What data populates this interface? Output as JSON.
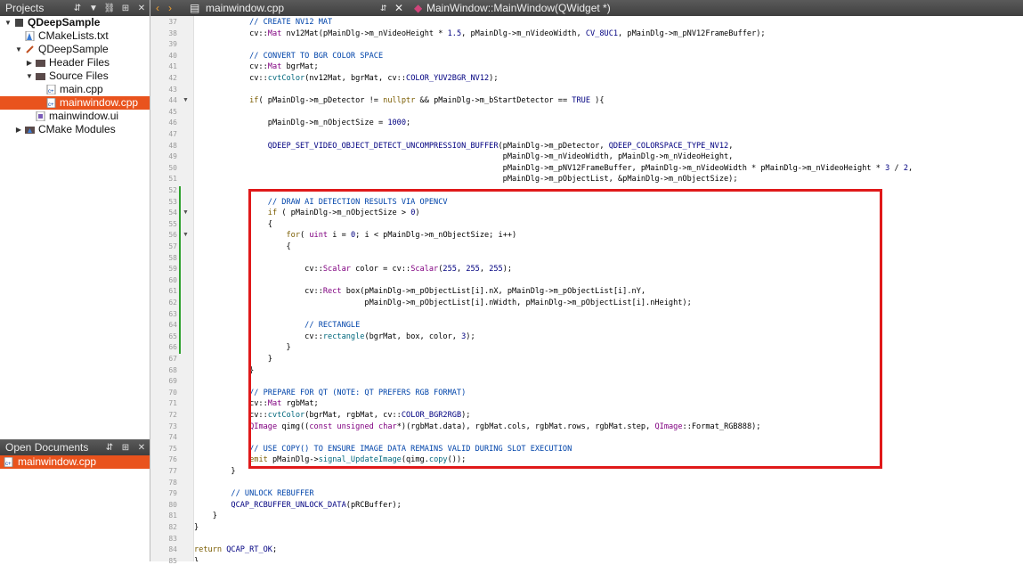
{
  "projects_panel": {
    "title": "Projects",
    "tree": [
      {
        "label": "QDeepSample",
        "depth": 0,
        "expanded": true,
        "bold": true,
        "icon": "project-icon"
      },
      {
        "label": "CMakeLists.txt",
        "depth": 1,
        "icon": "cmake-file-icon"
      },
      {
        "label": "QDeepSample",
        "depth": 1,
        "expanded": true,
        "icon": "target-icon"
      },
      {
        "label": "Header Files",
        "depth": 2,
        "expanded": false,
        "icon": "folder-icon"
      },
      {
        "label": "Source Files",
        "depth": 2,
        "expanded": true,
        "icon": "folder-icon"
      },
      {
        "label": "main.cpp",
        "depth": 3,
        "icon": "cpp-file-icon"
      },
      {
        "label": "mainwindow.cpp",
        "depth": 3,
        "icon": "cpp-file-icon",
        "selected": true
      },
      {
        "label": "mainwindow.ui",
        "depth": 2,
        "icon": "ui-file-icon"
      },
      {
        "label": "CMake Modules",
        "depth": 1,
        "expanded": false,
        "icon": "cmake-folder-icon"
      }
    ]
  },
  "open_documents": {
    "title": "Open Documents",
    "items": [
      {
        "label": "mainwindow.cpp",
        "selected": true
      }
    ]
  },
  "editor": {
    "file_tab": "mainwindow.cpp",
    "symbol": "MainWindow::MainWindow(QWidget *)",
    "lines": [
      {
        "n": "37",
        "t": "            // CREATE NV12 MAT"
      },
      {
        "n": "38",
        "t": "            cv::Mat nv12Mat(pMainDlg->m_nVideoHeight * 1.5, pMainDlg->m_nVideoWidth, CV_8UC1, pMainDlg->m_pNV12FrameBuffer);"
      },
      {
        "n": "39",
        "t": ""
      },
      {
        "n": "40",
        "t": "            // CONVERT TO BGR COLOR SPACE"
      },
      {
        "n": "41",
        "t": "            cv::Mat bgrMat;"
      },
      {
        "n": "42",
        "t": "            cv::cvtColor(nv12Mat, bgrMat, cv::COLOR_YUV2BGR_NV12);"
      },
      {
        "n": "43",
        "t": ""
      },
      {
        "n": "44",
        "t": "            if( pMainDlg->m_pDetector != nullptr && pMainDlg->m_bStartDetector == TRUE ){"
      },
      {
        "n": "45",
        "t": ""
      },
      {
        "n": "46",
        "t": "                pMainDlg->m_nObjectSize = 1000;"
      },
      {
        "n": "47",
        "t": ""
      },
      {
        "n": "48",
        "t": "                QDEEP_SET_VIDEO_OBJECT_DETECT_UNCOMPRESSION_BUFFER(pMainDlg->m_pDetector, QDEEP_COLORSPACE_TYPE_NV12,"
      },
      {
        "n": "49",
        "t": "                                                                   pMainDlg->m_nVideoWidth, pMainDlg->m_nVideoHeight,"
      },
      {
        "n": "50",
        "t": "                                                                   pMainDlg->m_pNV12FrameBuffer, pMainDlg->m_nVideoWidth * pMainDlg->m_nVideoHeight * 3 / 2,"
      },
      {
        "n": "51",
        "t": "                                                                   pMainDlg->m_pObjectList, &pMainDlg->m_nObjectSize);"
      },
      {
        "n": "52",
        "t": ""
      },
      {
        "n": "53",
        "t": "                // DRAW AI DETECTION RESULTS VIA OPENCV"
      },
      {
        "n": "54",
        "t": "                if ( pMainDlg->m_nObjectSize > 0)"
      },
      {
        "n": "55",
        "t": "                {"
      },
      {
        "n": "56",
        "t": "                    for( uint i = 0; i < pMainDlg->m_nObjectSize; i++)"
      },
      {
        "n": "57",
        "t": "                    {"
      },
      {
        "n": "58",
        "t": ""
      },
      {
        "n": "59",
        "t": "                        cv::Scalar color = cv::Scalar(255, 255, 255);"
      },
      {
        "n": "60",
        "t": ""
      },
      {
        "n": "61",
        "t": "                        cv::Rect box(pMainDlg->m_pObjectList[i].nX, pMainDlg->m_pObjectList[i].nY,"
      },
      {
        "n": "62",
        "t": "                                     pMainDlg->m_pObjectList[i].nWidth, pMainDlg->m_pObjectList[i].nHeight);"
      },
      {
        "n": "63",
        "t": ""
      },
      {
        "n": "64",
        "t": "                        // RECTANGLE"
      },
      {
        "n": "65",
        "t": "                        cv::rectangle(bgrMat, box, color, 3);"
      },
      {
        "n": "66",
        "t": "                    }"
      },
      {
        "n": "67",
        "t": "                }"
      },
      {
        "n": "68",
        "t": "            }"
      },
      {
        "n": "69",
        "t": ""
      },
      {
        "n": "70",
        "t": "            // PREPARE FOR QT (NOTE: QT PREFERS RGB FORMAT)"
      },
      {
        "n": "71",
        "t": "            cv::Mat rgbMat;"
      },
      {
        "n": "72",
        "t": "            cv::cvtColor(bgrMat, rgbMat, cv::COLOR_BGR2RGB);"
      },
      {
        "n": "73",
        "t": "            QImage qimg((const unsigned char*)(rgbMat.data), rgbMat.cols, rgbMat.rows, rgbMat.step, QImage::Format_RGB888);"
      },
      {
        "n": "74",
        "t": ""
      },
      {
        "n": "75",
        "t": "            // USE COPY() TO ENSURE IMAGE DATA REMAINS VALID DURING SLOT EXECUTION"
      },
      {
        "n": "76",
        "t": "            emit pMainDlg->signal_UpdateImage(qimg.copy());"
      },
      {
        "n": "77",
        "t": "        }"
      },
      {
        "n": "78",
        "t": ""
      },
      {
        "n": "79",
        "t": "        // UNLOCK REBUFFER"
      },
      {
        "n": "80",
        "t": "        QCAP_RCBUFFER_UNLOCK_DATA(pRCBuffer);"
      },
      {
        "n": "81",
        "t": "    }"
      },
      {
        "n": "82",
        "t": "}"
      },
      {
        "n": "83",
        "t": ""
      },
      {
        "n": "84",
        "t": "return QCAP_RT_OK;"
      },
      {
        "n": "85",
        "t": "}"
      }
    ],
    "fold_markers": [
      "44",
      "54",
      "56"
    ]
  },
  "colors": {
    "selection": "#e9531d",
    "highlight_box": "#e0191a",
    "comment": "#0044aa",
    "change_bar": "#2ca02c"
  }
}
